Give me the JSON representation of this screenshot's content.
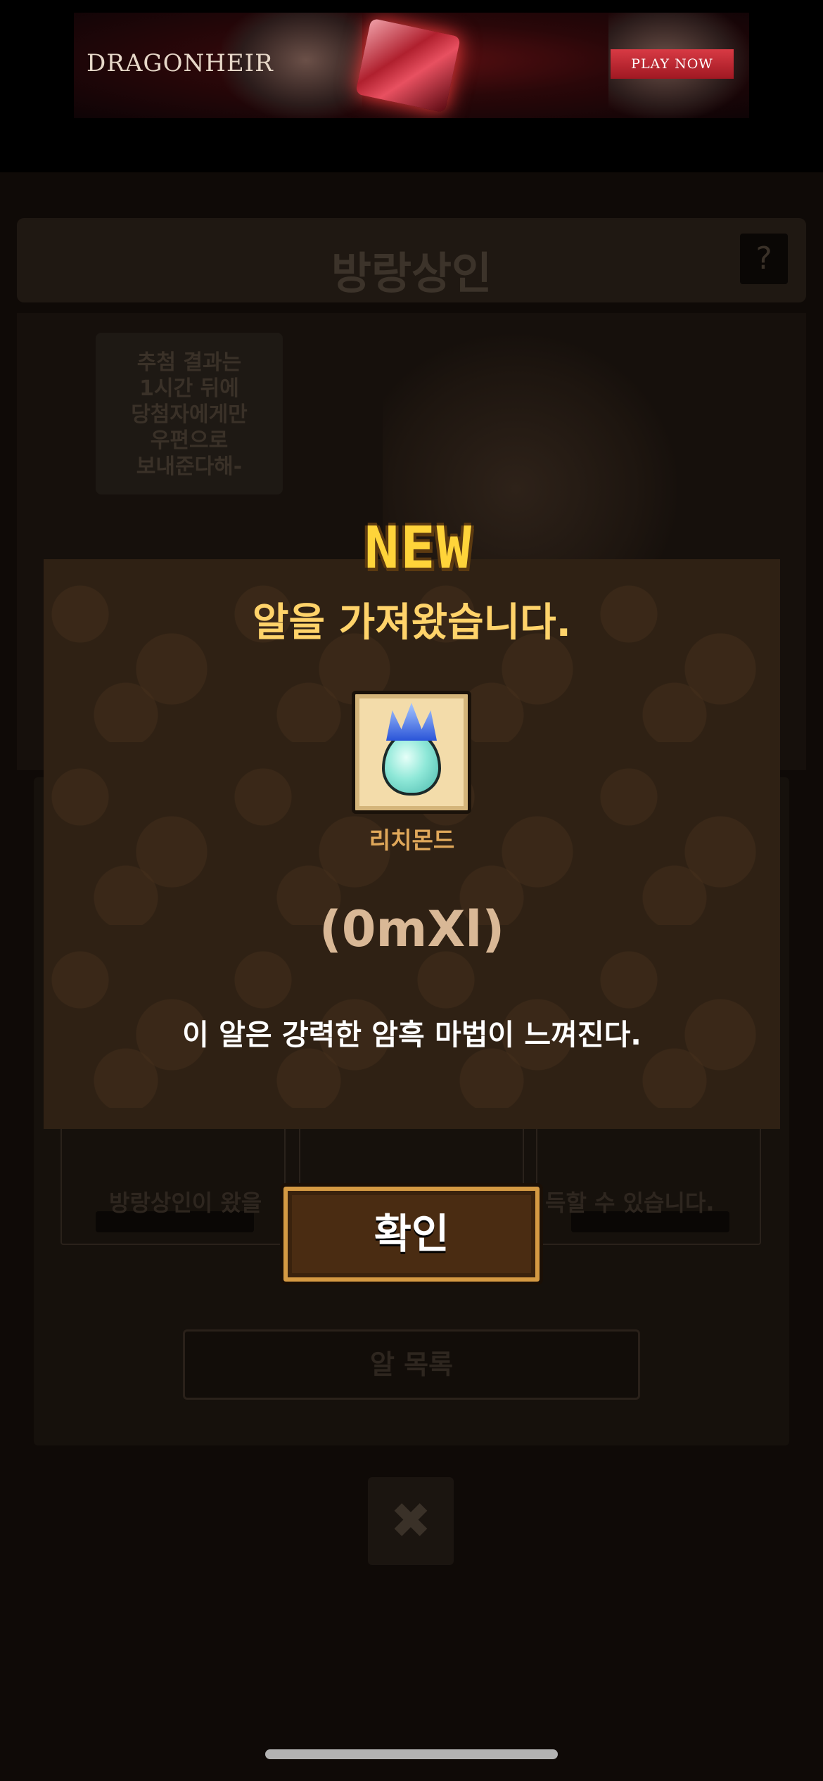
{
  "ad": {
    "logo_text": "DRAGONHEIR",
    "cta_label": "PLAY NOW"
  },
  "game": {
    "title": "방랑상인",
    "help_label": "?",
    "speech_lines": [
      "추첨 결과는",
      "1시간 뒤에",
      "당첨자에게만",
      "우편으로",
      "보내준다해-"
    ],
    "info_left": "방랑상인이 왔을",
    "info_right": "득할 수 있습니다.",
    "list_button_label": "알 목록",
    "close_label": "✖"
  },
  "modal": {
    "badge": "NEW",
    "title": "알을 가져왔습니다.",
    "egg_name": "리치몬드",
    "egg_code": "(0mXl)",
    "description": "이 알은 강력한 암흑 마법이 느껴진다.",
    "confirm_label": "확인"
  }
}
